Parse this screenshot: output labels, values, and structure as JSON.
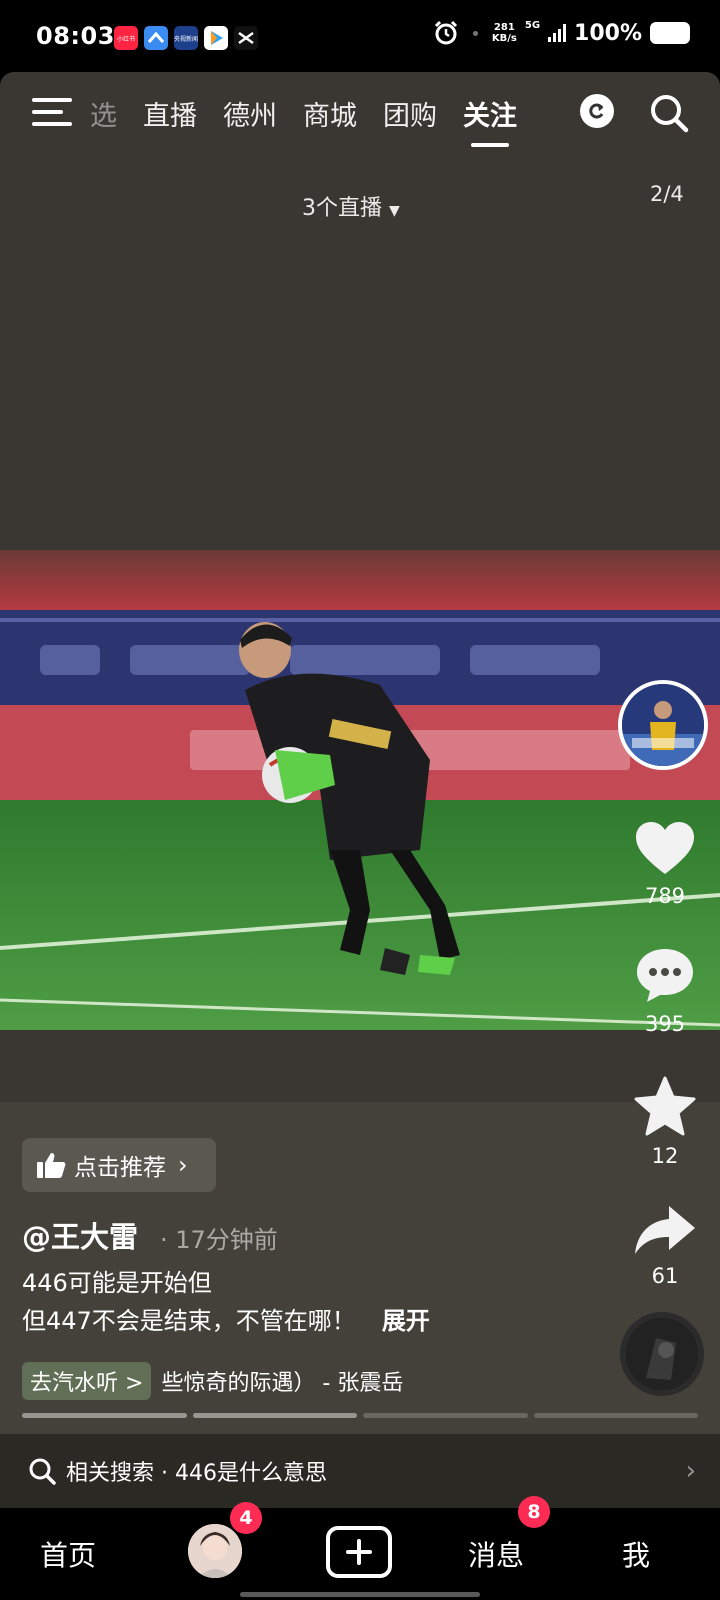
{
  "status_bar": {
    "time": "08:03",
    "apps": [
      {
        "name": "xiaohongshu-icon",
        "label": "小红书",
        "color": "#ff2442"
      },
      {
        "name": "wps-icon",
        "label": "",
        "color": "#3b8cf0"
      },
      {
        "name": "cctv-news-icon",
        "label": "央视新闻",
        "color": "#1e3f8c"
      },
      {
        "name": "tencent-video-icon",
        "label": "",
        "color": "#2aa3f5"
      },
      {
        "name": "capcut-icon",
        "label": "",
        "color": "#111111"
      }
    ],
    "net_speed_value": "281",
    "net_speed_unit": "KB/s",
    "network": "5G",
    "battery": "100%"
  },
  "top_nav": {
    "tabs": [
      {
        "label": "选",
        "state": "faded"
      },
      {
        "label": "直播",
        "state": "normal"
      },
      {
        "label": "德州",
        "state": "normal"
      },
      {
        "label": "商城",
        "state": "normal"
      },
      {
        "label": "团购",
        "state": "normal"
      },
      {
        "label": "关注",
        "state": "active"
      }
    ],
    "icons": [
      "menu-icon",
      "refresh-icon",
      "search-icon"
    ]
  },
  "live_count": "3个直播",
  "page_indicator": "2/4",
  "actions": {
    "likes": "789",
    "comments": "395",
    "favorites": "12",
    "shares": "61"
  },
  "recommend_label": "点击推荐",
  "author": "@王大雷",
  "time_ago": "· 17分钟前",
  "caption_line1": "446可能是开始但",
  "caption_line2": "但447不会是结束，不管在哪！",
  "expand_label": "展开",
  "music_tag": "去汽水听 >",
  "music_title": "些惊奇的际遇） - 张震岳",
  "related_search": "相关搜索 · 446是什么意思",
  "bottom_nav": {
    "home": "首页",
    "friends_badge": "4",
    "messages": "消息",
    "messages_badge": "8",
    "me": "我"
  },
  "colors": {
    "badge": "#fe2c55",
    "video_bg": "#3a3631",
    "pitch_green": "#3f8f3a"
  }
}
